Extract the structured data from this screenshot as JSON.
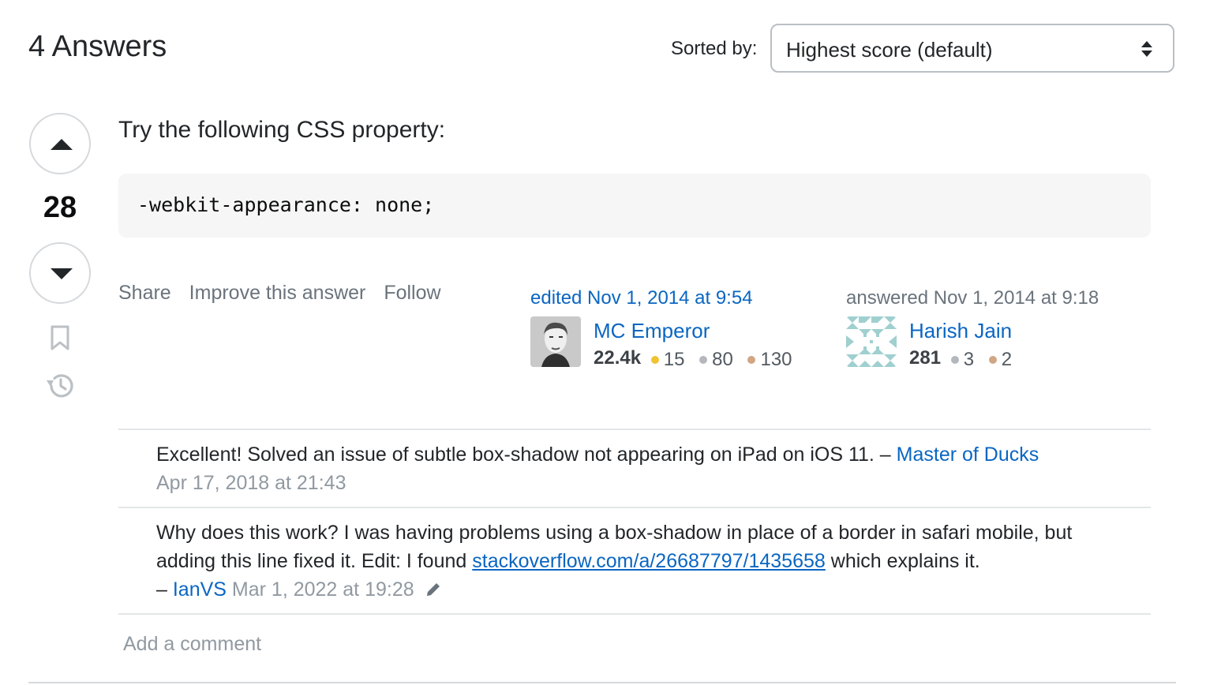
{
  "header": {
    "title": "4 Answers",
    "sort_label": "Sorted by:",
    "sort_value": "Highest score (default)"
  },
  "answer": {
    "score": "28",
    "text": "Try the following CSS property:",
    "code": "-webkit-appearance: none;",
    "menu": [
      "Share",
      "Improve this answer",
      "Follow"
    ],
    "edited": {
      "action": "edited Nov 1, 2014 at 9:54",
      "user": "MC Emperor",
      "reputation": "22.4k",
      "gold": "15",
      "silver": "80",
      "bronze": "130"
    },
    "answered": {
      "action": "answered Nov 1, 2014 at 9:18",
      "user": "Harish Jain",
      "reputation": "281",
      "silver": "3",
      "bronze": "2"
    }
  },
  "comments": [
    {
      "text": "Excellent! Solved an issue of subtle box-shadow not appearing on iPad on iOS 11. –",
      "author": "Master of Ducks",
      "date": "Apr 17, 2018 at 21:43"
    },
    {
      "text_before": "Why does this work? I was having problems using a box-shadow in place of a border in safari mobile, but adding this line fixed it. Edit: I found",
      "link": "stackoverflow.com/a/26687797/1435658",
      "text_after": "which explains it.",
      "dash": "–",
      "author": "IanVS",
      "date": "Mar 1, 2022 at 19:28"
    }
  ],
  "add_comment": "Add a comment",
  "colors": {
    "link": "#0a66c2",
    "gold": "#f1c232",
    "silver": "#b4b8bc",
    "bronze": "#d1a684"
  },
  "icons": [
    "caret-up-icon",
    "caret-down-icon",
    "bookmark-icon",
    "history-icon",
    "sort-arrows-icon",
    "pencil-icon"
  ]
}
